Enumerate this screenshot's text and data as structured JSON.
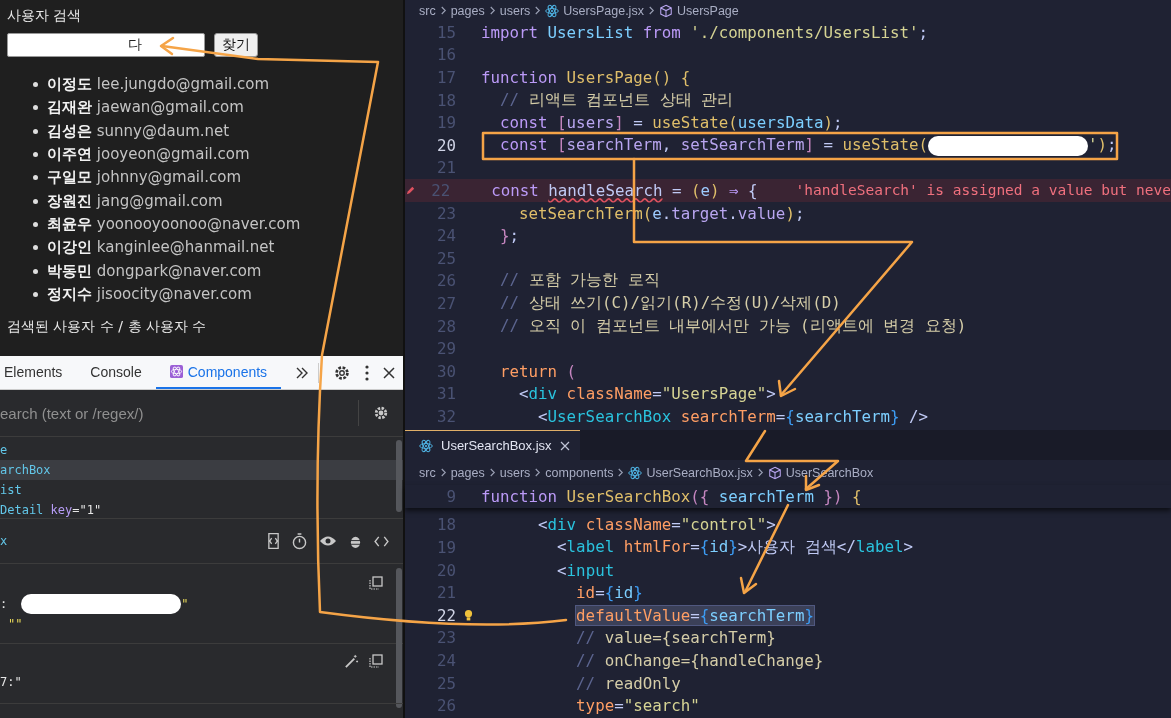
{
  "browser": {
    "label": "사용자 검색",
    "search_value": "다",
    "search_button": "찾기",
    "users": [
      {
        "name": "이정도",
        "email": "lee.jungdo@gmail.com"
      },
      {
        "name": "김재완",
        "email": "jaewan@gmail.com"
      },
      {
        "name": "김성은",
        "email": "sunny@daum.net"
      },
      {
        "name": "이주연",
        "email": "jooyeon@gmail.com"
      },
      {
        "name": "구일모",
        "email": "johnny@gmail.com"
      },
      {
        "name": "장원진",
        "email": "jang@gmail.com"
      },
      {
        "name": "최윤우",
        "email": "yoonooyoonoo@naver.com"
      },
      {
        "name": "이강인",
        "email": "kanginlee@hanmail.net"
      },
      {
        "name": "박동민",
        "email": "dongpark@naver.com"
      },
      {
        "name": "정지수",
        "email": "jisoocity@naver.com"
      }
    ],
    "summary": "검색된 사용자 수 / 총 사용자 수"
  },
  "devtools": {
    "tabs": [
      {
        "label": "Elements",
        "selected": false,
        "kind": "builtin"
      },
      {
        "label": "Console",
        "selected": false,
        "kind": "builtin"
      },
      {
        "label": "Components",
        "selected": true,
        "kind": "extension"
      }
    ],
    "search_placeholder": "earch (text or /regex/)",
    "tree": [
      {
        "name": "e",
        "selected": false
      },
      {
        "name": "archBox",
        "selected": true
      },
      {
        "name": "ist",
        "selected": false
      },
      {
        "name": "Detail",
        "prop": "key",
        "prop_value": "=\"1\"",
        "selected": false
      }
    ],
    "component": "x",
    "props": [
      {
        "text": ":",
        "redacted": true,
        "value": "\""
      },
      {
        "text": "\"\"",
        "redacted": false
      }
    ],
    "hooks": [
      {
        "text": "7:\""
      }
    ]
  },
  "editor_top": {
    "breadcrumb": [
      {
        "label": "src",
        "kind": "folder"
      },
      {
        "label": "pages",
        "kind": "folder"
      },
      {
        "label": "users",
        "kind": "folder"
      },
      {
        "label": "UsersPage.jsx",
        "kind": "file"
      },
      {
        "label": "UsersPage",
        "kind": "symbol"
      }
    ],
    "lines": [
      {
        "number": "15",
        "kind": "normal",
        "tokens": [
          {
            "kind": "kw",
            "text": "import "
          },
          {
            "kind": "typ",
            "text": "UsersList "
          },
          {
            "kind": "kw",
            "text": "from "
          },
          {
            "kind": "str",
            "text": "'./components/UsersList'"
          },
          {
            "kind": "pn",
            "text": ";"
          }
        ]
      },
      {
        "number": "16",
        "kind": "normal"
      },
      {
        "number": "17",
        "kind": "normal",
        "tokens": [
          {
            "kind": "kw",
            "text": "function "
          },
          {
            "kind": "fn",
            "text": "UsersPage"
          },
          {
            "kind": "fn",
            "text": "() {"
          }
        ]
      },
      {
        "number": "18",
        "kind": "normal",
        "tokens": [
          {
            "kind": "cm",
            "text": "  // "
          },
          {
            "kind": "cmt",
            "text": "리액트 컴포넌트 상태 관리"
          }
        ]
      },
      {
        "number": "19",
        "kind": "normal",
        "tokens": [
          {
            "kind": "kw",
            "text": "  const "
          },
          {
            "kind": "br",
            "text": "["
          },
          {
            "kind": "var",
            "text": "users"
          },
          {
            "kind": "br",
            "text": "]"
          },
          {
            "kind": "pn",
            "text": " = "
          },
          {
            "kind": "fn",
            "text": "useState"
          },
          {
            "kind": "fn",
            "text": "("
          },
          {
            "kind": "typ",
            "text": "usersData"
          },
          {
            "kind": "fn",
            "text": ")"
          },
          {
            "kind": "pn",
            "text": ";"
          }
        ]
      },
      {
        "number": "20",
        "kind": "current",
        "tokens": [
          {
            "kind": "kw",
            "text": "  const "
          },
          {
            "kind": "br",
            "text": "["
          },
          {
            "kind": "var",
            "text": "searchTerm"
          },
          {
            "kind": "pn",
            "text": ", "
          },
          {
            "kind": "var",
            "text": "setSearchTerm"
          },
          {
            "kind": "br",
            "text": "]"
          },
          {
            "kind": "pn",
            "text": " = "
          },
          {
            "kind": "fn",
            "text": "useState"
          },
          {
            "kind": "fn",
            "text": "("
          },
          {
            "kind": "redacted"
          },
          {
            "kind": "str",
            "text": "'"
          },
          {
            "kind": "fn",
            "text": ")"
          },
          {
            "kind": "pn",
            "text": ";"
          }
        ]
      },
      {
        "number": "21",
        "kind": "normal"
      },
      {
        "number": "22",
        "kind": "error",
        "diagnostic": "'handleSearch' is assigned a value but neve",
        "tokens": [
          {
            "kind": "kw",
            "text": "  const "
          },
          {
            "kind": "errv",
            "text": "handleSearch"
          },
          {
            "kind": "pn",
            "text": " = "
          },
          {
            "kind": "fn",
            "text": "("
          },
          {
            "kind": "param",
            "text": "e"
          },
          {
            "kind": "fn",
            "text": ") "
          },
          {
            "kind": "kw",
            "text": "⇒"
          },
          {
            "kind": "pn",
            "text": " {"
          }
        ]
      },
      {
        "number": "23",
        "kind": "normal",
        "tokens": [
          {
            "kind": "fn",
            "text": "    setSearchTerm"
          },
          {
            "kind": "fn",
            "text": "("
          },
          {
            "kind": "param",
            "text": "e"
          },
          {
            "kind": "pn",
            "text": "."
          },
          {
            "kind": "var",
            "text": "target"
          },
          {
            "kind": "pn",
            "text": "."
          },
          {
            "kind": "var",
            "text": "value"
          },
          {
            "kind": "fn",
            "text": ")"
          },
          {
            "kind": "pn",
            "text": ";"
          }
        ]
      },
      {
        "number": "24",
        "kind": "normal",
        "tokens": [
          {
            "kind": "br",
            "text": "  }"
          },
          {
            "kind": "pn",
            "text": ";"
          }
        ]
      },
      {
        "number": "25",
        "kind": "normal"
      },
      {
        "number": "26",
        "kind": "normal",
        "tokens": [
          {
            "kind": "cm",
            "text": "  // "
          },
          {
            "kind": "cmt",
            "text": "포함 가능한 로직"
          }
        ]
      },
      {
        "number": "27",
        "kind": "normal",
        "tokens": [
          {
            "kind": "cm",
            "text": "  // "
          },
          {
            "kind": "cmt",
            "text": "상태 쓰기(C)/읽기(R)/수정(U)/삭제(D)"
          }
        ]
      },
      {
        "number": "28",
        "kind": "normal",
        "tokens": [
          {
            "kind": "cm",
            "text": "  // "
          },
          {
            "kind": "cmt",
            "text": "오직 이 컴포넌트 내부에서만 가능 (리액트에 변경 요청)"
          }
        ]
      },
      {
        "number": "29",
        "kind": "normal"
      },
      {
        "number": "30",
        "kind": "normal",
        "tokens": [
          {
            "kind": "attr",
            "text": "  return "
          },
          {
            "kind": "br",
            "text": "("
          }
        ]
      },
      {
        "number": "31",
        "kind": "normal",
        "tokens": [
          {
            "kind": "pn",
            "text": "    <"
          },
          {
            "kind": "tag",
            "text": "div"
          },
          {
            "kind": "attr",
            "text": " className"
          },
          {
            "kind": "pn",
            "text": "="
          },
          {
            "kind": "str",
            "text": "\"UsersPage\""
          },
          {
            "kind": "pn",
            "text": ">"
          }
        ]
      },
      {
        "number": "32",
        "kind": "normal",
        "tokens": [
          {
            "kind": "pn",
            "text": "      <"
          },
          {
            "kind": "tag",
            "text": "UserSearchBox"
          },
          {
            "kind": "attr",
            "text": " searchTerm"
          },
          {
            "kind": "pn",
            "text": "="
          },
          {
            "kind": "brace",
            "text": "{"
          },
          {
            "kind": "typ",
            "text": "searchTerm"
          },
          {
            "kind": "brace",
            "text": "}"
          },
          {
            "kind": "pn",
            "text": " />"
          }
        ]
      }
    ]
  },
  "editor_bottom": {
    "tab": {
      "label": "UserSearchBox.jsx",
      "selected": true
    },
    "breadcrumb": [
      {
        "label": "src",
        "kind": "folder"
      },
      {
        "label": "pages",
        "kind": "folder"
      },
      {
        "label": "users",
        "kind": "folder"
      },
      {
        "label": "components",
        "kind": "folder"
      },
      {
        "label": "UserSearchBox.jsx",
        "kind": "file"
      },
      {
        "label": "UserSearchBox",
        "kind": "symbol"
      }
    ],
    "sticky": {
      "number": "9",
      "tokens": [
        {
          "kind": "kw",
          "text": "function "
        },
        {
          "kind": "fn",
          "text": "UserSearchBox"
        },
        {
          "kind": "br",
          "text": "({ "
        },
        {
          "kind": "typ",
          "text": "searchTerm"
        },
        {
          "kind": "br",
          "text": " })"
        },
        {
          "kind": "fn",
          "text": " {"
        }
      ]
    },
    "lines": [
      {
        "number": "18",
        "kind": "normal",
        "tokens": [
          {
            "kind": "pn",
            "text": "      <"
          },
          {
            "kind": "tag",
            "text": "div"
          },
          {
            "kind": "attr",
            "text": " className"
          },
          {
            "kind": "pn",
            "text": "="
          },
          {
            "kind": "str",
            "text": "\"control\""
          },
          {
            "kind": "pn",
            "text": ">"
          }
        ]
      },
      {
        "number": "19",
        "kind": "normal",
        "tokens": [
          {
            "kind": "pn",
            "text": "        <"
          },
          {
            "kind": "tag",
            "text": "label"
          },
          {
            "kind": "attr",
            "text": " htmlFor"
          },
          {
            "kind": "pn",
            "text": "="
          },
          {
            "kind": "brace",
            "text": "{"
          },
          {
            "kind": "typ",
            "text": "id"
          },
          {
            "kind": "brace",
            "text": "}"
          },
          {
            "kind": "pn",
            "text": ">사용자 검색</"
          },
          {
            "kind": "tag",
            "text": "label"
          },
          {
            "kind": "pn",
            "text": ">"
          }
        ]
      },
      {
        "number": "20",
        "kind": "normal",
        "tokens": [
          {
            "kind": "pn",
            "text": "        <"
          },
          {
            "kind": "tag",
            "text": "input"
          }
        ]
      },
      {
        "number": "21",
        "kind": "normal",
        "tokens": [
          {
            "kind": "attr",
            "text": "          id"
          },
          {
            "kind": "pn",
            "text": "="
          },
          {
            "kind": "brace",
            "text": "{"
          },
          {
            "kind": "typ",
            "text": "id"
          },
          {
            "kind": "brace",
            "text": "}"
          }
        ]
      },
      {
        "number": "22",
        "kind": "selection",
        "tokens": [
          {
            "kind": "attr",
            "text": "          defaultValue"
          },
          {
            "kind": "pn",
            "text": "="
          },
          {
            "kind": "brace",
            "text": "{"
          },
          {
            "kind": "typ",
            "text": "searchTerm"
          },
          {
            "kind": "brace",
            "text": "}"
          }
        ]
      },
      {
        "number": "23",
        "kind": "normal",
        "tokens": [
          {
            "kind": "cm",
            "text": "          // "
          },
          {
            "kind": "cmt",
            "text": "value={searchTerm}"
          }
        ]
      },
      {
        "number": "24",
        "kind": "normal",
        "tokens": [
          {
            "kind": "cm",
            "text": "          // "
          },
          {
            "kind": "cmt",
            "text": "onChange={handleChange}"
          }
        ]
      },
      {
        "number": "25",
        "kind": "normal",
        "tokens": [
          {
            "kind": "cm",
            "text": "          // "
          },
          {
            "kind": "cmt",
            "text": "readOnly"
          }
        ]
      },
      {
        "number": "26",
        "kind": "normal",
        "tokens": [
          {
            "kind": "attr",
            "text": "          type"
          },
          {
            "kind": "pn",
            "text": "="
          },
          {
            "kind": "str",
            "text": "\"search\""
          }
        ]
      }
    ]
  }
}
